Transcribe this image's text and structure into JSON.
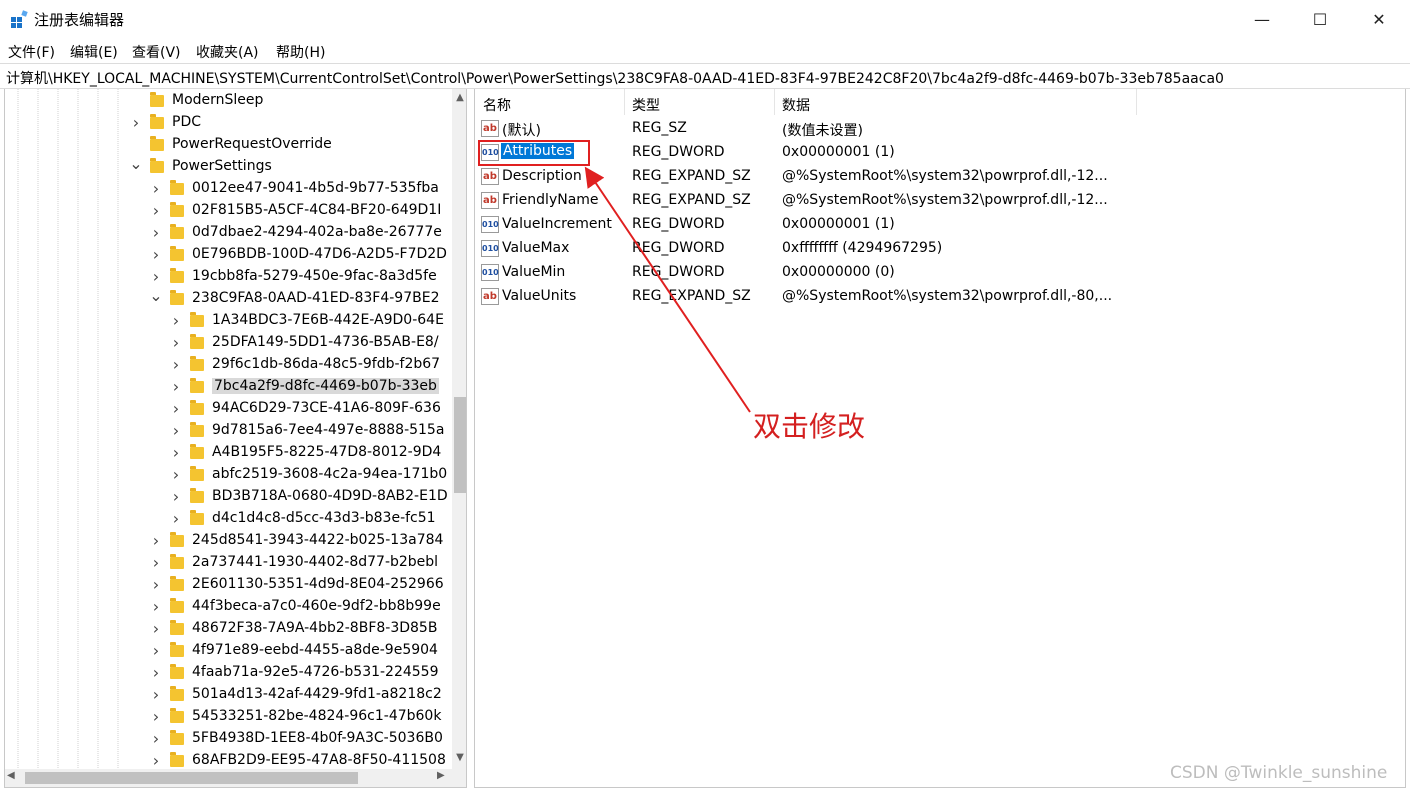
{
  "window": {
    "title": "注册表编辑器",
    "min_glyph": "—",
    "max_glyph": "☐",
    "close_glyph": "✕"
  },
  "menu": [
    "文件(F)",
    "编辑(E)",
    "查看(V)",
    "收藏夹(A)",
    "帮助(H)"
  ],
  "address": "计算机\\HKEY_LOCAL_MACHINE\\SYSTEM\\CurrentControlSet\\Control\\Power\\PowerSettings\\238C9FA8-0AAD-41ED-83F4-97BE242C8F20\\7bc4a2f9-d8fc-4469-b07b-33eb785aaca0",
  "tree": [
    {
      "label": "ModernSleep",
      "level": 0,
      "chevron": ""
    },
    {
      "label": "PDC",
      "level": 0,
      "chevron": ">"
    },
    {
      "label": "PowerRequestOverride",
      "level": 0,
      "chevron": ""
    },
    {
      "label": "PowerSettings",
      "level": 0,
      "chevron": "v"
    },
    {
      "label": "0012ee47-9041-4b5d-9b77-535fba",
      "level": 1,
      "chevron": ">"
    },
    {
      "label": "02F815B5-A5CF-4C84-BF20-649D1I",
      "level": 1,
      "chevron": ">"
    },
    {
      "label": "0d7dbae2-4294-402a-ba8e-26777e",
      "level": 1,
      "chevron": ">"
    },
    {
      "label": "0E796BDB-100D-47D6-A2D5-F7D2D",
      "level": 1,
      "chevron": ">"
    },
    {
      "label": "19cbb8fa-5279-450e-9fac-8a3d5fe",
      "level": 1,
      "chevron": ">"
    },
    {
      "label": "238C9FA8-0AAD-41ED-83F4-97BE2",
      "level": 1,
      "chevron": "v"
    },
    {
      "label": "1A34BDC3-7E6B-442E-A9D0-64E",
      "level": 2,
      "chevron": ">"
    },
    {
      "label": "25DFA149-5DD1-4736-B5AB-E8/",
      "level": 2,
      "chevron": ">"
    },
    {
      "label": "29f6c1db-86da-48c5-9fdb-f2b67",
      "level": 2,
      "chevron": ">"
    },
    {
      "label": "7bc4a2f9-d8fc-4469-b07b-33eb",
      "level": 2,
      "chevron": ">",
      "selected": true
    },
    {
      "label": "94AC6D29-73CE-41A6-809F-636",
      "level": 2,
      "chevron": ">"
    },
    {
      "label": "9d7815a6-7ee4-497e-8888-515a",
      "level": 2,
      "chevron": ">"
    },
    {
      "label": "A4B195F5-8225-47D8-8012-9D4",
      "level": 2,
      "chevron": ">"
    },
    {
      "label": "abfc2519-3608-4c2a-94ea-171b0",
      "level": 2,
      "chevron": ">"
    },
    {
      "label": "BD3B718A-0680-4D9D-8AB2-E1D",
      "level": 2,
      "chevron": ">"
    },
    {
      "label": "d4c1d4c8-d5cc-43d3-b83e-fc51",
      "level": 2,
      "chevron": ">"
    },
    {
      "label": "245d8541-3943-4422-b025-13a784",
      "level": 1,
      "chevron": ">"
    },
    {
      "label": "2a737441-1930-4402-8d77-b2bebl",
      "level": 1,
      "chevron": ">"
    },
    {
      "label": "2E601130-5351-4d9d-8E04-252966",
      "level": 1,
      "chevron": ">"
    },
    {
      "label": "44f3beca-a7c0-460e-9df2-bb8b99e",
      "level": 1,
      "chevron": ">"
    },
    {
      "label": "48672F38-7A9A-4bb2-8BF8-3D85B",
      "level": 1,
      "chevron": ">"
    },
    {
      "label": "4f971e89-eebd-4455-a8de-9e5904",
      "level": 1,
      "chevron": ">"
    },
    {
      "label": "4faab71a-92e5-4726-b531-224559",
      "level": 1,
      "chevron": ">"
    },
    {
      "label": "501a4d13-42af-4429-9fd1-a8218c2",
      "level": 1,
      "chevron": ">"
    },
    {
      "label": "54533251-82be-4824-96c1-47b60k",
      "level": 1,
      "chevron": ">"
    },
    {
      "label": "5FB4938D-1EE8-4b0f-9A3C-5036B0",
      "level": 1,
      "chevron": ">"
    },
    {
      "label": "68AFB2D9-EE95-47A8-8F50-411508",
      "level": 1,
      "chevron": ">"
    }
  ],
  "columns": {
    "name": "名称",
    "type": "类型",
    "data": "数据"
  },
  "values": [
    {
      "icon": "ab",
      "kind": "string-value-icon",
      "name": "(默认)",
      "type": "REG_SZ",
      "data": "(数值未设置)"
    },
    {
      "icon": "010",
      "kind": "binary-value-icon",
      "name": "Attributes",
      "type": "REG_DWORD",
      "data": "0x00000001 (1)",
      "selected": true
    },
    {
      "icon": "ab",
      "kind": "string-value-icon",
      "name": "Description",
      "type": "REG_EXPAND_SZ",
      "data": "@%SystemRoot%\\system32\\powrprof.dll,-12..."
    },
    {
      "icon": "ab",
      "kind": "string-value-icon",
      "name": "FriendlyName",
      "type": "REG_EXPAND_SZ",
      "data": "@%SystemRoot%\\system32\\powrprof.dll,-12..."
    },
    {
      "icon": "010",
      "kind": "binary-value-icon",
      "name": "ValueIncrement",
      "type": "REG_DWORD",
      "data": "0x00000001 (1)"
    },
    {
      "icon": "010",
      "kind": "binary-value-icon",
      "name": "ValueMax",
      "type": "REG_DWORD",
      "data": "0xffffffff (4294967295)"
    },
    {
      "icon": "010",
      "kind": "binary-value-icon",
      "name": "ValueMin",
      "type": "REG_DWORD",
      "data": "0x00000000 (0)"
    },
    {
      "icon": "ab",
      "kind": "string-value-icon",
      "name": "ValueUnits",
      "type": "REG_EXPAND_SZ",
      "data": "@%SystemRoot%\\system32\\powrprof.dll,-80,..."
    }
  ],
  "annotation": {
    "text": "双击修改",
    "color": "#d42020"
  },
  "watermark": "CSDN @Twinkle_sunshine",
  "colors": {
    "selection": "#0078d7",
    "folder": "#f4c430",
    "highlight_border": "#e02020"
  }
}
